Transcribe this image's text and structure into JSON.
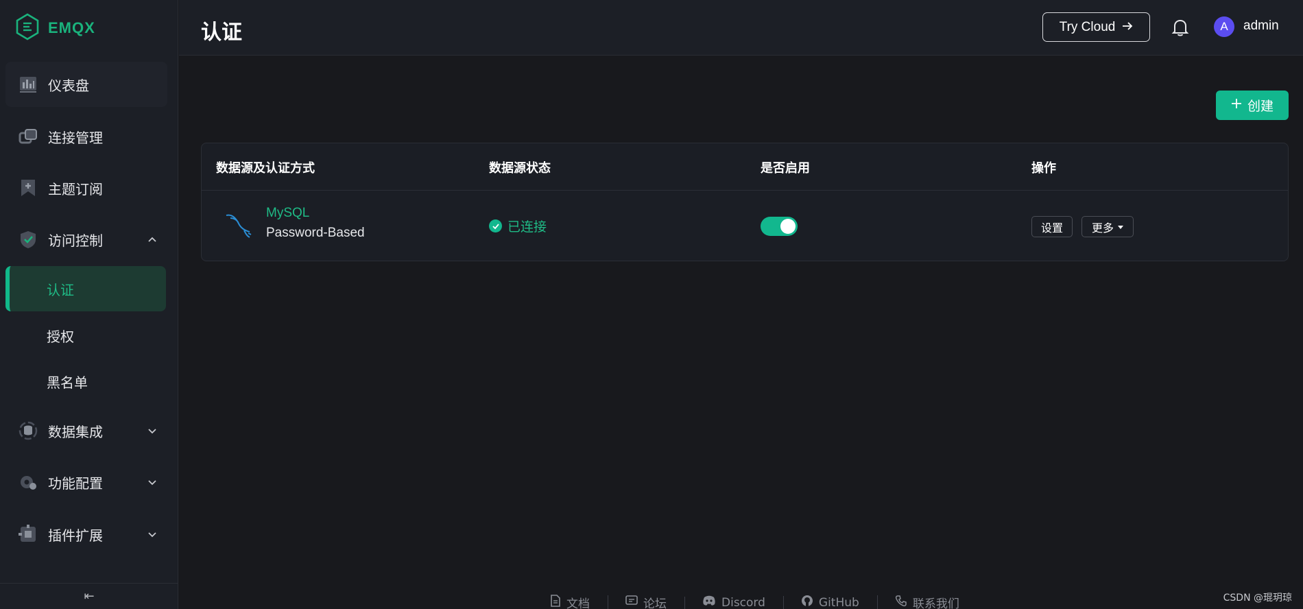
{
  "brand": {
    "name": "EMQX"
  },
  "sidebar": {
    "items": [
      {
        "label": "仪表盘",
        "icon": "dashboard-icon"
      },
      {
        "label": "连接管理",
        "icon": "connections-icon"
      },
      {
        "label": "主题订阅",
        "icon": "topic-subscribe-icon"
      },
      {
        "label": "访问控制",
        "icon": "shield-icon",
        "expanded": true
      },
      {
        "label": "数据集成",
        "icon": "data-integration-icon"
      },
      {
        "label": "功能配置",
        "icon": "feature-config-icon"
      },
      {
        "label": "插件扩展",
        "icon": "plugin-icon"
      }
    ],
    "subitems": [
      {
        "label": "认证",
        "active": true
      },
      {
        "label": "授权"
      },
      {
        "label": "黑名单"
      }
    ],
    "collapse_glyph": "⇤"
  },
  "header": {
    "title": "认证",
    "try_cloud": "Try Cloud",
    "avatar_letter": "A",
    "username": "admin"
  },
  "main": {
    "create_label": "创建",
    "table": {
      "columns": [
        "数据源及认证方式",
        "数据源状态",
        "是否启用",
        "操作"
      ],
      "rows": [
        {
          "source": "MySQL",
          "mechanism": "Password-Based",
          "status": "已连接",
          "enabled": true,
          "settings_label": "设置",
          "more_label": "更多"
        }
      ]
    }
  },
  "footer": {
    "links": [
      {
        "label": "文档",
        "icon": "document-icon"
      },
      {
        "label": "论坛",
        "icon": "forum-icon"
      },
      {
        "label": "Discord",
        "icon": "discord-icon"
      },
      {
        "label": "GitHub",
        "icon": "github-icon"
      },
      {
        "label": "联系我们",
        "icon": "phone-icon"
      }
    ]
  },
  "watermark": "CSDN @琨玥琼",
  "colors": {
    "accent": "#12b78e",
    "sidebar_bg": "#1c1f26",
    "page_bg": "#18191d"
  }
}
